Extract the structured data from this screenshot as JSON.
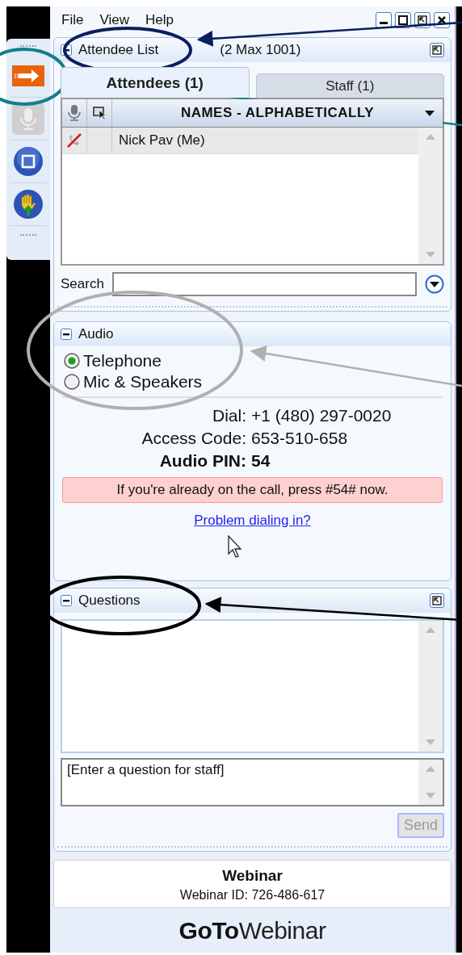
{
  "menu": [
    "File",
    "View",
    "Help"
  ],
  "side_toolbar": [
    {
      "kind": "arrow",
      "disabled": false
    },
    {
      "kind": "mic",
      "disabled": true
    },
    {
      "kind": "square",
      "disabled": false
    },
    {
      "kind": "hand",
      "disabled": false
    }
  ],
  "attendee_panel": {
    "title": "Attendee List",
    "count": "(2 Max 1001)",
    "tabs": [
      {
        "label": "Attendees (1)",
        "selected": true
      },
      {
        "label": "Staff (1)",
        "selected": false
      }
    ],
    "table": {
      "columns": [
        "NAMES - ALPHABETICALLY"
      ],
      "rows": [
        {
          "name": "Nick Pav (Me)",
          "muted": true
        }
      ]
    },
    "search": {
      "label": "Search"
    }
  },
  "audio_panel": {
    "title": "Audio",
    "options": [
      {
        "label": "Telephone",
        "selected": true
      },
      {
        "label": "Mic & Speakers",
        "selected": false
      }
    ],
    "details": [
      {
        "label": "Dial:",
        "value": "+1 (480) 297-0020",
        "bold": false
      },
      {
        "label": "Access Code:",
        "value": "653-510-658",
        "bold": false
      },
      {
        "label": "Audio PIN:",
        "value": "54",
        "bold": true
      }
    ],
    "notice": "If you're already on the call, press #54# now.",
    "link": "Problem dialing in?"
  },
  "questions_panel": {
    "title": "Questions",
    "placeholder": "[Enter a question for staff]",
    "send": "Send",
    "send_disabled": true
  },
  "footer": {
    "title": "Webinar",
    "webinar_id": "Webinar ID: 726-486-617",
    "logo_bold": "GoTo",
    "logo_light": "Webinar"
  }
}
